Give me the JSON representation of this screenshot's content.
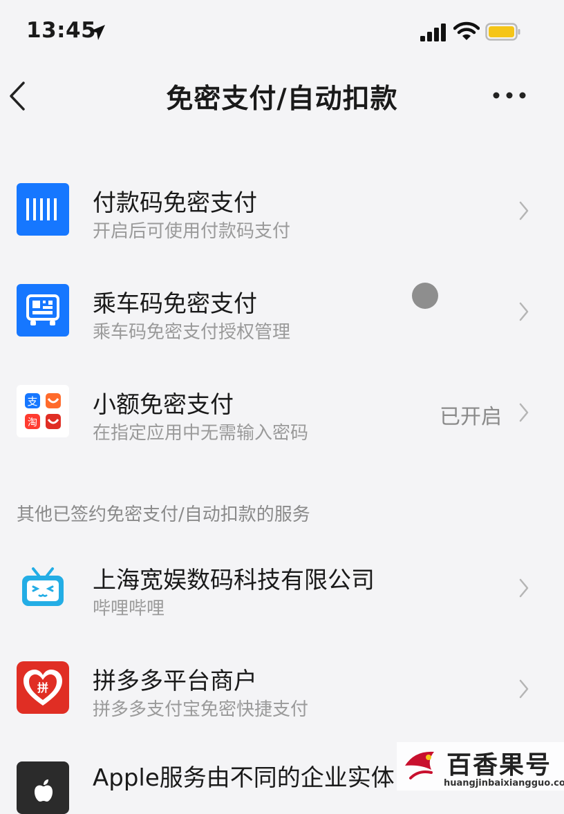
{
  "status_bar": {
    "time": "13:45"
  },
  "nav": {
    "title": "免密支付/自动扣款"
  },
  "rows": [
    {
      "title": "付款码免密支付",
      "subtitle": "开启后可使用付款码支付"
    },
    {
      "title": "乘车码免密支付",
      "subtitle": "乘车码免密支付授权管理"
    },
    {
      "title": "小额免密支付",
      "subtitle": "在指定应用中无需输入密码",
      "value": "已开启"
    }
  ],
  "section": {
    "label": "其他已签约免密支付/自动扣款的服务"
  },
  "services": [
    {
      "title": "上海宽娱数码科技有限公司",
      "subtitle": "哔哩哔哩"
    },
    {
      "title": "拼多多平台商户",
      "subtitle": "拼多多支付宝免密快捷支付"
    },
    {
      "title": "Apple服务由不同的企业实体"
    }
  ],
  "watermark": {
    "brand": "百香果号",
    "url": "huangjinbaixiangguo.com"
  },
  "colors": {
    "accent_blue": "#1677ff",
    "pdd_red": "#e02e24",
    "bili_blue": "#23ade5"
  }
}
